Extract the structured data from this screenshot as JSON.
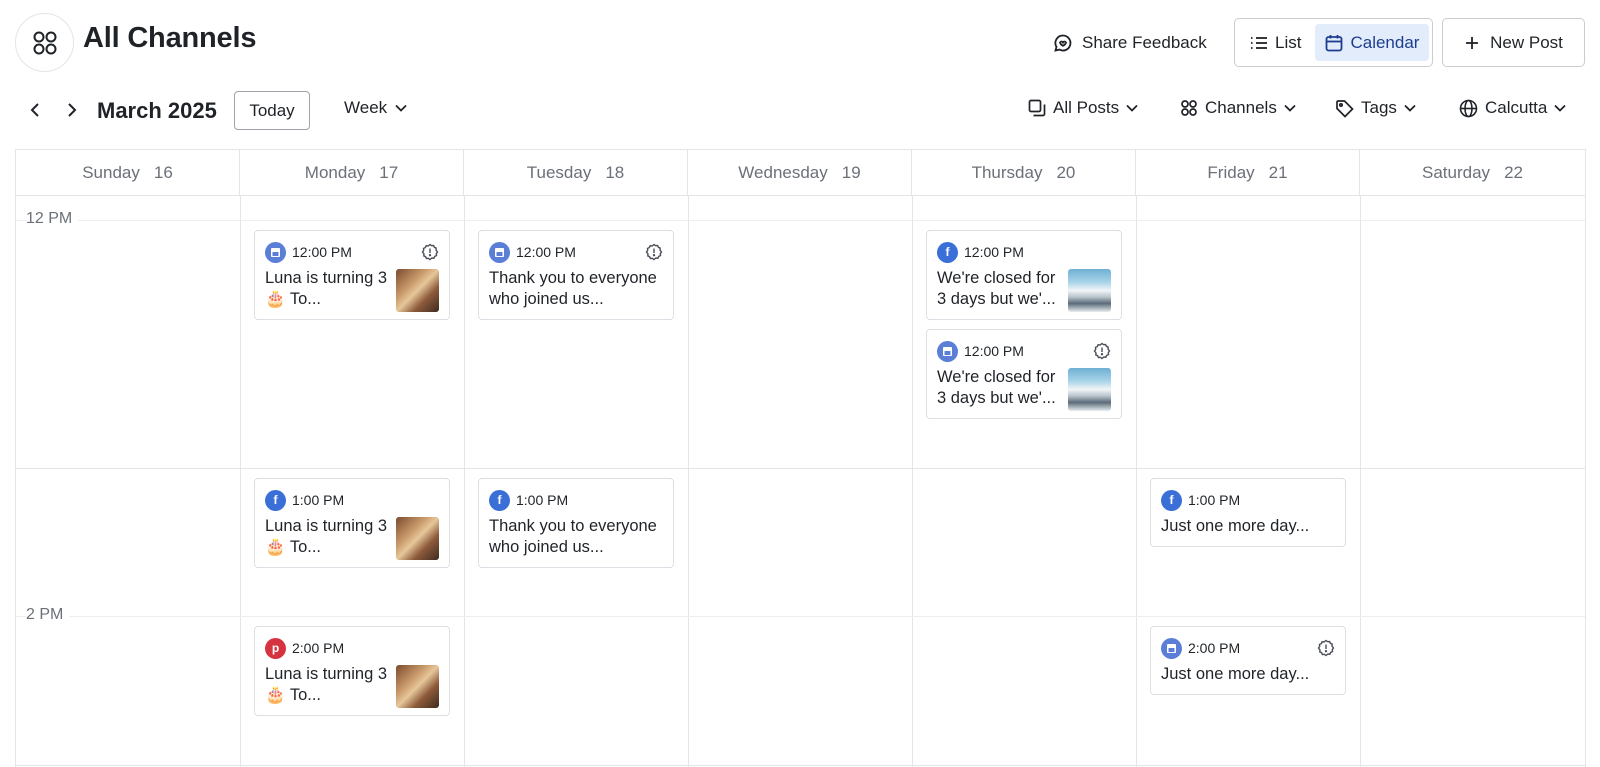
{
  "header": {
    "title": "All Channels",
    "share_feedback": "Share Feedback",
    "view_list": "List",
    "view_calendar": "Calendar",
    "new_post": "New Post"
  },
  "toolbar": {
    "month": "March 2025",
    "today": "Today",
    "range": "Week",
    "filters": {
      "posts": "All Posts",
      "channels": "Channels",
      "tags": "Tags",
      "timezone": "Calcutta"
    }
  },
  "calendar": {
    "days": [
      {
        "name": "Sunday",
        "num": "16"
      },
      {
        "name": "Monday",
        "num": "17"
      },
      {
        "name": "Tuesday",
        "num": "18"
      },
      {
        "name": "Wednesday",
        "num": "19"
      },
      {
        "name": "Thursday",
        "num": "20"
      },
      {
        "name": "Friday",
        "num": "21"
      },
      {
        "name": "Saturday",
        "num": "22"
      }
    ],
    "time_labels": [
      "12 PM",
      "2 PM"
    ],
    "posts": [
      {
        "time": "12:00 PM",
        "text": "Luna is turning 3 🎂 To...",
        "channel": "business-profile",
        "warning": true
      },
      {
        "time": "12:00 PM",
        "text": "Thank you to everyone who joined us...",
        "channel": "business-profile",
        "warning": true
      },
      {
        "time": "12:00 PM",
        "text": "We're closed for 3 days but we'...",
        "channel": "facebook",
        "warning": false
      },
      {
        "time": "12:00 PM",
        "text": "We're closed for 3 days but we'...",
        "channel": "business-profile",
        "warning": true
      },
      {
        "time": "1:00 PM",
        "text": "Luna is turning 3 🎂 To...",
        "channel": "facebook",
        "warning": false
      },
      {
        "time": "1:00 PM",
        "text": "Thank you to everyone who joined us...",
        "channel": "facebook",
        "warning": false
      },
      {
        "time": "1:00 PM",
        "text": "Just one more day...",
        "channel": "facebook",
        "warning": false
      },
      {
        "time": "2:00 PM",
        "text": "Luna is turning 3 🎂 To...",
        "channel": "pinterest",
        "warning": false
      },
      {
        "time": "2:00 PM",
        "text": "Just one more day...",
        "channel": "business-profile",
        "warning": true
      }
    ]
  },
  "colors": {
    "accent": "#1d3d91",
    "accent_bg": "#e3ecfb",
    "facebook": "#3b6fd8",
    "pinterest": "#d63340",
    "business_profile": "#5b7fd6"
  }
}
